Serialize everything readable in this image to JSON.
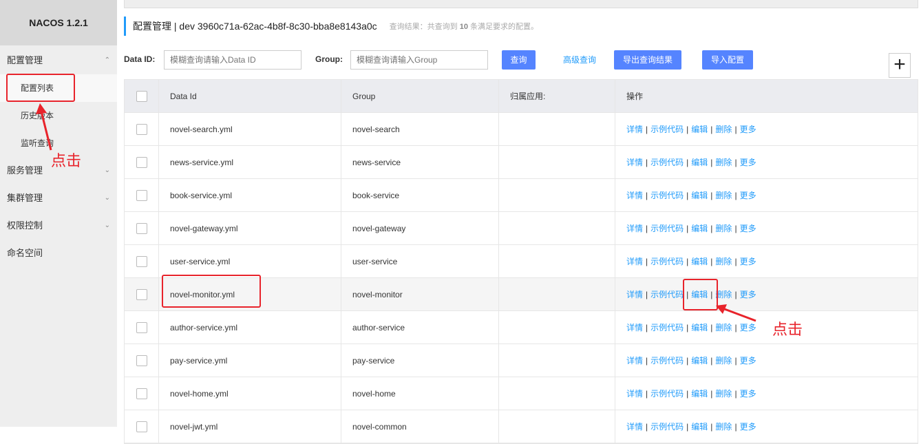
{
  "sidebar": {
    "logo": "NACOS 1.2.1",
    "groups": [
      {
        "label": "配置管理",
        "expanded": true,
        "items": [
          "配置列表",
          "历史版本",
          "监听查询"
        ]
      },
      {
        "label": "服务管理",
        "expanded": false
      },
      {
        "label": "集群管理",
        "expanded": false
      },
      {
        "label": "权限控制",
        "expanded": false
      },
      {
        "label": "命名空间"
      }
    ]
  },
  "header": {
    "title": "配置管理 | dev 3960c71a-62ac-4b8f-8c30-bba8e8143a0c",
    "result_prefix": "查询结果：共查询到",
    "result_count": "10",
    "result_suffix": "条满足要求的配置。"
  },
  "search": {
    "dataid_label": "Data ID:",
    "dataid_placeholder": "模糊查询请输入Data ID",
    "group_label": "Group:",
    "group_placeholder": "模糊查询请输入Group",
    "query_button": "查询",
    "advanced_link": "高级查询",
    "export_button": "导出查询结果",
    "import_button": "导入配置",
    "add_button": "+"
  },
  "table": {
    "columns": [
      "Data Id",
      "Group",
      "归属应用:",
      "操作"
    ],
    "rows": [
      {
        "data_id": "novel-search.yml",
        "group": "novel-search",
        "app": ""
      },
      {
        "data_id": "news-service.yml",
        "group": "news-service",
        "app": ""
      },
      {
        "data_id": "book-service.yml",
        "group": "book-service",
        "app": ""
      },
      {
        "data_id": "novel-gateway.yml",
        "group": "novel-gateway",
        "app": ""
      },
      {
        "data_id": "user-service.yml",
        "group": "user-service",
        "app": ""
      },
      {
        "data_id": "novel-monitor.yml",
        "group": "novel-monitor",
        "app": ""
      },
      {
        "data_id": "author-service.yml",
        "group": "author-service",
        "app": ""
      },
      {
        "data_id": "pay-service.yml",
        "group": "pay-service",
        "app": ""
      },
      {
        "data_id": "novel-home.yml",
        "group": "novel-home",
        "app": ""
      },
      {
        "data_id": "novel-jwt.yml",
        "group": "novel-common",
        "app": ""
      }
    ],
    "ops": [
      "详情",
      "示例代码",
      "编辑",
      "删除",
      "更多"
    ],
    "separator": "|"
  },
  "annotations": {
    "click_label_1": "点击",
    "click_label_2": "点击"
  },
  "colors": {
    "accent": "#5584ff",
    "link": "#209bfa",
    "annotation": "#e8232b",
    "sidebar_bg": "#eeeeee"
  }
}
